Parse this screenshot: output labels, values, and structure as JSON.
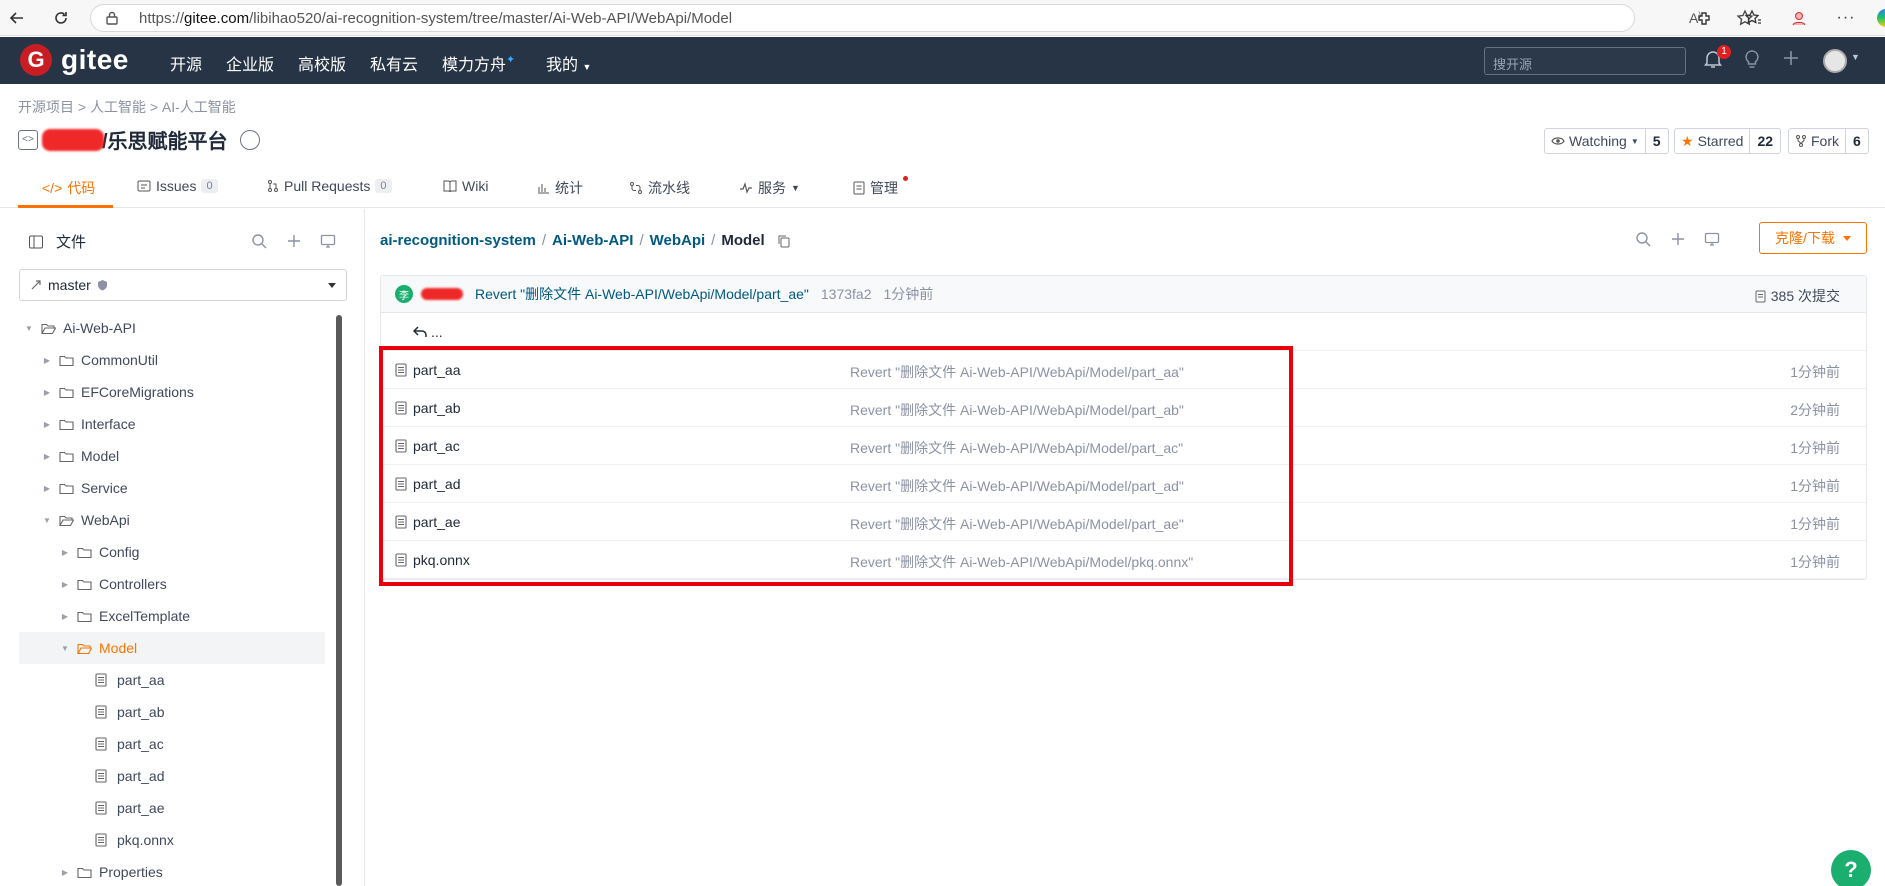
{
  "browser": {
    "url_prefix": "https://",
    "url_domain": "gitee.com",
    "url_path": "/libihao520/ai-recognition-system/tree/master/Ai-Web-API/WebApi/Model"
  },
  "topnav": {
    "logo_text": "gitee",
    "logo_letter": "G",
    "items": [
      "开源",
      "企业版",
      "高校版",
      "私有云",
      "模力方舟",
      "我的"
    ],
    "search_placeholder": "搜开源",
    "notification_count": "1"
  },
  "project": {
    "breadcrumb": "开源项目 > 人工智能 > AI-人工智能",
    "title": "/乐思赋能平台",
    "watching_label": "Watching",
    "watching_count": "5",
    "starred_label": "Starred",
    "starred_count": "22",
    "fork_label": "Fork",
    "fork_count": "6"
  },
  "tabs": {
    "code": "代码",
    "issues": "Issues",
    "issues_count": "0",
    "pulls": "Pull Requests",
    "pulls_count": "0",
    "wiki": "Wiki",
    "stats": "统计",
    "pipeline": "流水线",
    "services": "服务",
    "manage": "管理"
  },
  "sidebar": {
    "title": "文件",
    "branch": "master",
    "tree": [
      {
        "label": "Ai-Web-API",
        "depth": 0,
        "type": "folder",
        "open": true
      },
      {
        "label": "CommonUtil",
        "depth": 1,
        "type": "folder"
      },
      {
        "label": "EFCoreMigrations",
        "depth": 1,
        "type": "folder"
      },
      {
        "label": "Interface",
        "depth": 1,
        "type": "folder"
      },
      {
        "label": "Model",
        "depth": 1,
        "type": "folder"
      },
      {
        "label": "Service",
        "depth": 1,
        "type": "folder"
      },
      {
        "label": "WebApi",
        "depth": 1,
        "type": "folder",
        "open": true
      },
      {
        "label": "Config",
        "depth": 2,
        "type": "folder"
      },
      {
        "label": "Controllers",
        "depth": 2,
        "type": "folder"
      },
      {
        "label": "ExcelTemplate",
        "depth": 2,
        "type": "folder"
      },
      {
        "label": "Model",
        "depth": 2,
        "type": "folder",
        "open": true,
        "active": true
      },
      {
        "label": "part_aa",
        "depth": 3,
        "type": "file"
      },
      {
        "label": "part_ab",
        "depth": 3,
        "type": "file"
      },
      {
        "label": "part_ac",
        "depth": 3,
        "type": "file"
      },
      {
        "label": "part_ad",
        "depth": 3,
        "type": "file"
      },
      {
        "label": "part_ae",
        "depth": 3,
        "type": "file"
      },
      {
        "label": "pkq.onnx",
        "depth": 3,
        "type": "file"
      },
      {
        "label": "Properties",
        "depth": 2,
        "type": "folder"
      }
    ]
  },
  "path": {
    "repo": "ai-recognition-system",
    "seg1": "Ai-Web-API",
    "seg2": "WebApi",
    "current": "Model",
    "sep": "/"
  },
  "clone_label": "克隆/下载",
  "commit": {
    "avatar_letter": "李",
    "message": "Revert \"删除文件 Ai-Web-API/WebApi/Model/part_ae\"",
    "hash": "1373fa2",
    "time": "1分钟前",
    "count": "385 次提交"
  },
  "up_label": "...",
  "files": [
    {
      "name": "part_aa",
      "message": "Revert \"删除文件 Ai-Web-API/WebApi/Model/part_aa\"",
      "time": "1分钟前"
    },
    {
      "name": "part_ab",
      "message": "Revert \"删除文件 Ai-Web-API/WebApi/Model/part_ab\"",
      "time": "2分钟前"
    },
    {
      "name": "part_ac",
      "message": "Revert \"删除文件 Ai-Web-API/WebApi/Model/part_ac\"",
      "time": "1分钟前"
    },
    {
      "name": "part_ad",
      "message": "Revert \"删除文件 Ai-Web-API/WebApi/Model/part_ad\"",
      "time": "1分钟前"
    },
    {
      "name": "part_ae",
      "message": "Revert \"删除文件 Ai-Web-API/WebApi/Model/part_ae\"",
      "time": "1分钟前"
    },
    {
      "name": "pkq.onnx",
      "message": "Revert \"删除文件 Ai-Web-API/WebApi/Model/pkq.onnx\"",
      "time": "1分钟前"
    }
  ],
  "help_label": "?",
  "colors": {
    "accent": "#fe7300",
    "nav_bg": "#263445",
    "link": "#005980",
    "highlight": "#e8000b",
    "help": "#1aae6f"
  }
}
